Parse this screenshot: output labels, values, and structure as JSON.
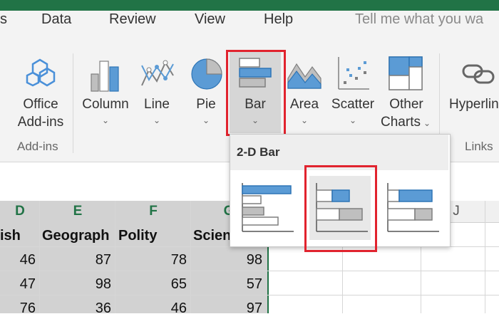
{
  "menu": {
    "partial": "s",
    "items": [
      "Data",
      "Review",
      "View",
      "Help"
    ],
    "tell_me": "Tell me what you wa"
  },
  "ribbon": {
    "addins": {
      "label1": "Office",
      "label2": "Add-ins",
      "group": "Add-ins"
    },
    "charts": {
      "column": "Column",
      "line": "Line",
      "pie": "Pie",
      "bar": "Bar",
      "area": "Area",
      "scatter": "Scatter",
      "other1": "Other",
      "other2": "Charts"
    },
    "links": {
      "hyperlink": "Hyperlin",
      "group": "Links"
    },
    "chevron": "⌄"
  },
  "dropdown": {
    "title": "2-D Bar",
    "options": [
      "Clustered Bar",
      "Stacked Bar",
      "100% Stacked Bar"
    ]
  },
  "sheet": {
    "columns": [
      "D",
      "E",
      "F",
      "G"
    ],
    "extra_column": "J",
    "headers": [
      "ish",
      "Geograph",
      "Polity",
      "Scien"
    ],
    "rows": [
      [
        "46",
        "87",
        "78",
        "98"
      ],
      [
        "47",
        "98",
        "65",
        "57"
      ],
      [
        "76",
        "36",
        "46",
        "97"
      ]
    ]
  },
  "colors": {
    "accent": "#217346",
    "chart_blue": "#5b9bd5",
    "chart_gray": "#bfbfbf",
    "highlight": "#e1232e"
  }
}
